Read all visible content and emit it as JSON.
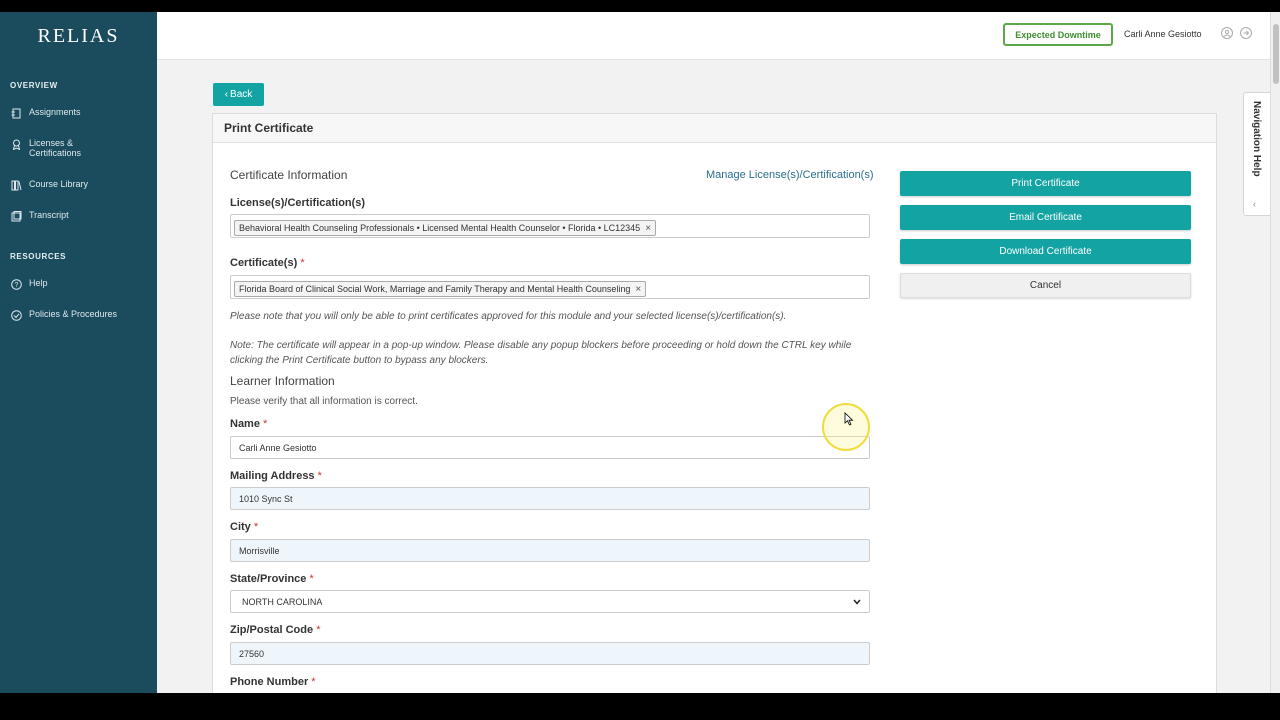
{
  "app": {
    "logo": "RELIAS"
  },
  "sidebar": {
    "sections": [
      {
        "title": "OVERVIEW"
      },
      {
        "title": "RESOURCES"
      }
    ],
    "items": [
      {
        "label": "Assignments",
        "icon": "assignments-icon"
      },
      {
        "label": "Licenses &",
        "label2": "Certifications",
        "icon": "license-icon"
      },
      {
        "label": "Course Library",
        "icon": "library-icon"
      },
      {
        "label": "Transcript",
        "icon": "transcript-icon"
      },
      {
        "label": "Help",
        "icon": "help-icon"
      },
      {
        "label": "Policies & Procedures",
        "icon": "check-circle-icon"
      }
    ]
  },
  "header": {
    "downtime_label": "Expected Downtime",
    "user_name": "Carli Anne Gesiotto"
  },
  "nav_help": {
    "label": "Navigation Help"
  },
  "back_label": "Back",
  "panel": {
    "title": "Print Certificate",
    "cert_info_title": "Certificate Information",
    "manage_link": "Manage License(s)/Certification(s)",
    "licenses_label": "License(s)/Certification(s)",
    "license_tag": "Behavioral Health Counseling Professionals • Licensed Mental Health Counselor • Florida • LC12345",
    "certificates_label": "Certificate(s)",
    "certificate_tag": "Florida Board of Clinical Social Work, Marriage and Family Therapy and Mental Health Counseling",
    "required_mark": "*",
    "note1": "Please note that you will only be able to print certificates approved for this module and your selected license(s)/certification(s).",
    "note2": "Note: The certificate will appear in a pop-up window. Please disable any popup blockers before proceeding or hold down the CTRL key while clicking the Print Certificate button to bypass any blockers.",
    "learner_title": "Learner Information",
    "verify_text": "Please verify that all information is correct.",
    "fields": {
      "name": {
        "label": "Name",
        "value": "Carli Anne Gesiotto"
      },
      "address": {
        "label": "Mailing Address",
        "value": "1010 Sync St"
      },
      "city": {
        "label": "City",
        "value": "Morrisville"
      },
      "state": {
        "label": "State/Province",
        "value": "NORTH CAROLINA"
      },
      "zip": {
        "label": "Zip/Postal Code",
        "value": "27560"
      },
      "phone": {
        "label": "Phone Number"
      }
    }
  },
  "actions": {
    "print": "Print Certificate",
    "email": "Email Certificate",
    "download": "Download Certificate",
    "cancel": "Cancel"
  },
  "colors": {
    "sidebar": "#1a4c5e",
    "accent": "#14a3a3",
    "downtime": "#5aa84a"
  }
}
